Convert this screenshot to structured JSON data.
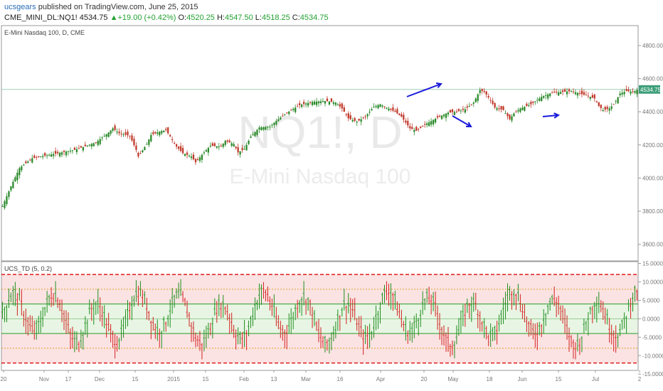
{
  "header": {
    "user": "ucsgears",
    "published_text": "published on TradingView.com, June 25, 2015",
    "symbol": "CME_MINI_DL:NQ1!",
    "last": "4534.75",
    "change": "+19.00 (+0.42%)",
    "o_label": "O:",
    "o_value": "4520.25",
    "h_label": "H:",
    "h_value": "4547.50",
    "l_label": "L:",
    "l_value": "4518.25",
    "c_label": "C:",
    "c_value": "4534.75"
  },
  "watermark": {
    "ticker": "NQ1!, D",
    "name": "E-Mini Nasdaq 100"
  },
  "colors": {
    "up": "#2a8a2a",
    "down": "#c0392b",
    "arrow": "#1a1adc",
    "band_red": "#fbe3e3",
    "band_green": "#e8f5e4"
  },
  "chart_data": [
    {
      "type": "candlestick",
      "title": "E-Mini Nasdaq 100, D, CME",
      "ylim": [
        3500,
        4920
      ],
      "y_ticks": [
        "3600.00",
        "3800.00",
        "4000.00",
        "4200.00",
        "4400.00",
        "4600.00",
        "4800.00"
      ],
      "last_value_label": "4534.75",
      "last_value": 4534.75,
      "x_ticks": [
        "20",
        "Nov",
        "17",
        "Dec",
        "15",
        "2015",
        "15",
        "Feb",
        "13",
        "Mar",
        "16",
        "Apr",
        "20",
        "May",
        "18",
        "Jun",
        "15",
        "Jul",
        "2"
      ],
      "close_path": [
        [
          0,
          3830
        ],
        [
          4,
          3950
        ],
        [
          8,
          4060
        ],
        [
          14,
          4120
        ],
        [
          22,
          4140
        ],
        [
          34,
          4170
        ],
        [
          44,
          4215
        ],
        [
          50,
          4275
        ],
        [
          52,
          4300
        ],
        [
          55,
          4270
        ],
        [
          60,
          4255
        ],
        [
          63,
          4170
        ],
        [
          64,
          4130
        ],
        [
          68,
          4205
        ],
        [
          70,
          4260
        ],
        [
          74,
          4280
        ],
        [
          77,
          4290
        ],
        [
          82,
          4190
        ],
        [
          85,
          4150
        ],
        [
          89,
          4130
        ],
        [
          91,
          4095
        ],
        [
          95,
          4155
        ],
        [
          98,
          4195
        ],
        [
          103,
          4190
        ],
        [
          105,
          4225
        ],
        [
          109,
          4205
        ],
        [
          111,
          4155
        ],
        [
          114,
          4175
        ],
        [
          117,
          4250
        ],
        [
          121,
          4305
        ],
        [
          126,
          4310
        ],
        [
          129,
          4345
        ],
        [
          134,
          4395
        ],
        [
          140,
          4440
        ],
        [
          146,
          4460
        ],
        [
          152,
          4465
        ],
        [
          157,
          4455
        ],
        [
          160,
          4420
        ],
        [
          163,
          4360
        ],
        [
          167,
          4340
        ],
        [
          171,
          4370
        ],
        [
          175,
          4430
        ],
        [
          178,
          4445
        ],
        [
          181,
          4425
        ],
        [
          185,
          4400
        ],
        [
          188,
          4370
        ],
        [
          192,
          4300
        ],
        [
          195,
          4285
        ],
        [
          200,
          4330
        ],
        [
          205,
          4365
        ],
        [
          210,
          4395
        ],
        [
          214,
          4400
        ],
        [
          218,
          4415
        ],
        [
          222,
          4455
        ],
        [
          225,
          4530
        ],
        [
          227,
          4520
        ],
        [
          230,
          4470
        ],
        [
          232,
          4425
        ],
        [
          236,
          4410
        ],
        [
          239,
          4355
        ],
        [
          241,
          4390
        ],
        [
          244,
          4420
        ],
        [
          249,
          4445
        ],
        [
          254,
          4490
        ],
        [
          259,
          4515
        ],
        [
          264,
          4520
        ],
        [
          268,
          4525
        ],
        [
          272,
          4510
        ],
        [
          276,
          4495
        ],
        [
          279,
          4480
        ],
        [
          281,
          4435
        ],
        [
          283,
          4410
        ],
        [
          286,
          4420
        ],
        [
          288,
          4445
        ],
        [
          291,
          4510
        ],
        [
          294,
          4525
        ],
        [
          297,
          4520
        ],
        [
          299,
          4532
        ]
      ]
    },
    {
      "type": "line",
      "title": "UCS_TD (5, 0.2)",
      "ylim": [
        -14,
        15.5
      ],
      "y_ticks": [
        "15.0000",
        "10.0000",
        "5.0000",
        "0.0000",
        "-5.0000",
        "-10.0000",
        "-15.0000"
      ],
      "levels": [
        -12,
        -8,
        -4,
        4,
        8,
        12
      ],
      "wave_amplitude": 5.5,
      "description_markers": []
    }
  ],
  "annotations": [
    {
      "name": "arrow-upper-rise"
    },
    {
      "name": "arrow-lower-fall"
    },
    {
      "name": "arrow-right-flat"
    }
  ]
}
